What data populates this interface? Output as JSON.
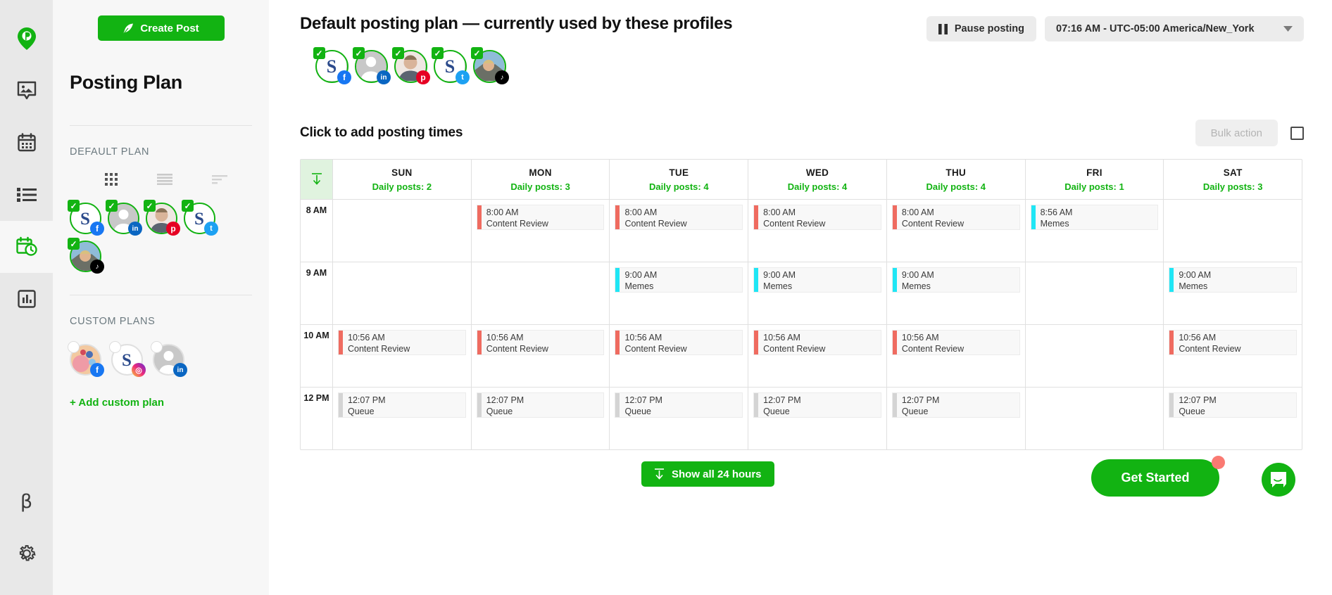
{
  "rail": {
    "logo": "pin-logo-icon",
    "items": [
      {
        "name": "media-library",
        "icon": "image-comment-icon",
        "active": false
      },
      {
        "name": "calendar",
        "icon": "calendar-icon",
        "active": false
      },
      {
        "name": "queue-list",
        "icon": "list-icon",
        "active": false
      },
      {
        "name": "posting-plan",
        "icon": "calendar-clock-icon",
        "active": true
      },
      {
        "name": "analytics",
        "icon": "bar-chart-icon",
        "active": false
      }
    ],
    "bottom": [
      {
        "name": "beta",
        "icon": "beta-icon",
        "label": "β"
      },
      {
        "name": "settings",
        "icon": "gear-icon"
      }
    ]
  },
  "sidebar": {
    "create_post_label": "Create Post",
    "create_post_icon": "feather-icon",
    "title": "Posting Plan",
    "default_plan_label": "DEFAULT PLAN",
    "custom_plans_label": "CUSTOM PLANS",
    "add_custom_plan_label": "+ Add custom plan",
    "view_toggles": [
      {
        "name": "grid-view-toggle",
        "icon": "grid-icon"
      },
      {
        "name": "list-view-toggle",
        "icon": "lines-icon"
      },
      {
        "name": "compact-view-toggle",
        "icon": "align-left-icon"
      }
    ],
    "default_plan_profiles": [
      {
        "network": "facebook",
        "checked": true,
        "avatar": "logo-s"
      },
      {
        "network": "linkedin",
        "checked": true,
        "avatar": "placeholder-person"
      },
      {
        "network": "pinterest",
        "checked": true,
        "avatar": "photo-man"
      },
      {
        "network": "twitter",
        "checked": true,
        "avatar": "logo-s"
      },
      {
        "network": "tiktok",
        "checked": true,
        "avatar": "photo-outdoor"
      }
    ],
    "custom_plan_profiles": [
      {
        "network": "facebook",
        "checked": false,
        "avatar": "photo-colorful"
      },
      {
        "network": "instagram",
        "checked": false,
        "avatar": "logo-s"
      },
      {
        "network": "linkedin",
        "checked": false,
        "avatar": "placeholder-person"
      }
    ]
  },
  "header": {
    "title": "Default posting plan — currently used by these profiles",
    "pause_label": "Pause posting",
    "pause_icon": "pause-icon",
    "timezone_value": "07:16 AM - UTC-05:00 America/New_York",
    "timezone_caret": "chevron-down-icon",
    "profiles": [
      {
        "network": "facebook",
        "checked": true,
        "avatar": "logo-s"
      },
      {
        "network": "linkedin",
        "checked": true,
        "avatar": "placeholder-person"
      },
      {
        "network": "pinterest",
        "checked": true,
        "avatar": "photo-man"
      },
      {
        "network": "twitter",
        "checked": true,
        "avatar": "logo-s"
      },
      {
        "network": "tiktok",
        "checked": true,
        "avatar": "photo-outdoor"
      }
    ]
  },
  "toolbar": {
    "subhead": "Click to add posting times",
    "bulk_action_label": "Bulk action",
    "select_all_name": "select-all-checkbox"
  },
  "calendar": {
    "gutter_icon": "sort-down-icon",
    "days": [
      {
        "name": "SUN",
        "daily_posts": "Daily posts: 2"
      },
      {
        "name": "MON",
        "daily_posts": "Daily posts: 3"
      },
      {
        "name": "TUE",
        "daily_posts": "Daily posts: 4"
      },
      {
        "name": "WED",
        "daily_posts": "Daily posts: 4"
      },
      {
        "name": "THU",
        "daily_posts": "Daily posts: 4"
      },
      {
        "name": "FRI",
        "daily_posts": "Daily posts: 1"
      },
      {
        "name": "SAT",
        "daily_posts": "Daily posts: 3"
      }
    ],
    "colors": {
      "content_review": "#ef6b60",
      "memes": "#1fe6f5",
      "queue": "#d4d4d4"
    },
    "rows": [
      {
        "hour": "8 AM",
        "cells": [
          [],
          [
            {
              "time": "8:00 AM",
              "label": "Content Review",
              "color": "#ef6b60"
            }
          ],
          [
            {
              "time": "8:00 AM",
              "label": "Content Review",
              "color": "#ef6b60"
            }
          ],
          [
            {
              "time": "8:00 AM",
              "label": "Content Review",
              "color": "#ef6b60"
            }
          ],
          [
            {
              "time": "8:00 AM",
              "label": "Content Review",
              "color": "#ef6b60"
            }
          ],
          [
            {
              "time": "8:56 AM",
              "label": "Memes",
              "color": "#1fe6f5"
            }
          ],
          []
        ]
      },
      {
        "hour": "9 AM",
        "cells": [
          [],
          [],
          [
            {
              "time": "9:00 AM",
              "label": "Memes",
              "color": "#1fe6f5"
            }
          ],
          [
            {
              "time": "9:00 AM",
              "label": "Memes",
              "color": "#1fe6f5"
            }
          ],
          [
            {
              "time": "9:00 AM",
              "label": "Memes",
              "color": "#1fe6f5"
            }
          ],
          [],
          [
            {
              "time": "9:00 AM",
              "label": "Memes",
              "color": "#1fe6f5"
            }
          ]
        ]
      },
      {
        "hour": "10 AM",
        "cells": [
          [
            {
              "time": "10:56 AM",
              "label": "Content Review",
              "color": "#ef6b60"
            }
          ],
          [
            {
              "time": "10:56 AM",
              "label": "Content Review",
              "color": "#ef6b60"
            }
          ],
          [
            {
              "time": "10:56 AM",
              "label": "Content Review",
              "color": "#ef6b60"
            }
          ],
          [
            {
              "time": "10:56 AM",
              "label": "Content Review",
              "color": "#ef6b60"
            }
          ],
          [
            {
              "time": "10:56 AM",
              "label": "Content Review",
              "color": "#ef6b60"
            }
          ],
          [],
          [
            {
              "time": "10:56 AM",
              "label": "Content Review",
              "color": "#ef6b60"
            }
          ]
        ]
      },
      {
        "hour": "12 PM",
        "cells": [
          [
            {
              "time": "12:07 PM",
              "label": "Queue",
              "color": "#d4d4d4"
            }
          ],
          [
            {
              "time": "12:07 PM",
              "label": "Queue",
              "color": "#d4d4d4"
            }
          ],
          [
            {
              "time": "12:07 PM",
              "label": "Queue",
              "color": "#d4d4d4"
            }
          ],
          [
            {
              "time": "12:07 PM",
              "label": "Queue",
              "color": "#d4d4d4"
            }
          ],
          [
            {
              "time": "12:07 PM",
              "label": "Queue",
              "color": "#d4d4d4"
            }
          ],
          [],
          [
            {
              "time": "12:07 PM",
              "label": "Queue",
              "color": "#d4d4d4"
            }
          ]
        ]
      }
    ]
  },
  "footer": {
    "show_all_label": "Show all 24 hours",
    "show_all_icon": "arrow-down-icon",
    "get_started_label": "Get Started",
    "intercom_icon": "chat-bubble-icon"
  },
  "theme": {
    "brand_green": "#12b312",
    "rail_bg": "#e8e8e8",
    "sidebar_bg": "#f7f7f7",
    "notification_red": "#fa7a72"
  }
}
